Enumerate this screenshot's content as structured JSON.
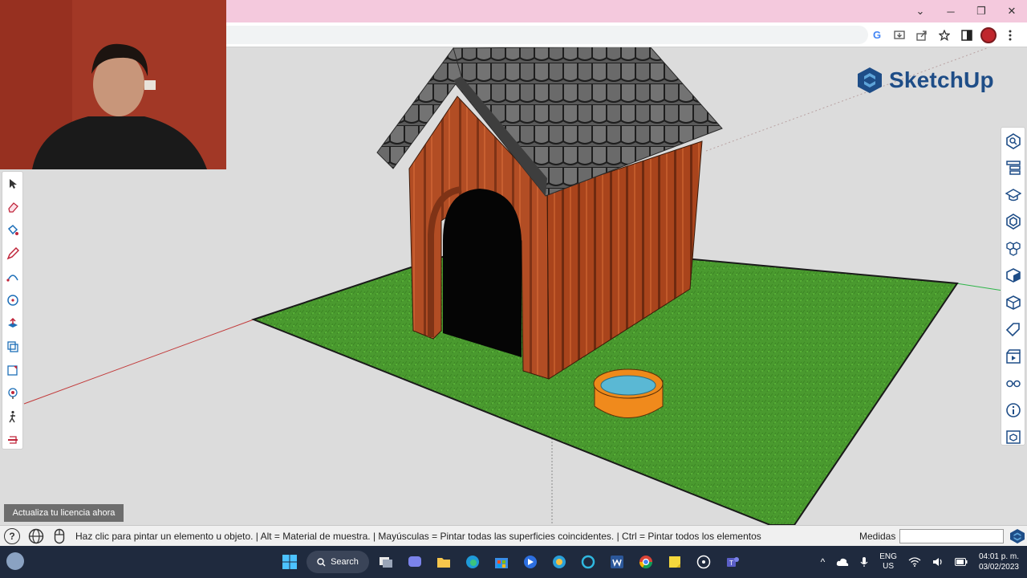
{
  "logo": {
    "text": "SketchUp"
  },
  "license_button": {
    "label": "Actualiza tu licencia ahora"
  },
  "statusbar": {
    "help_icon": "?",
    "hint": "Haz clic para pintar un elemento u objeto. | Alt = Material de muestra. | Mayúsculas = Pintar todas las superficies coincidentes. | Ctrl = Pintar todos los elementos",
    "measure_label": "Medidas",
    "measure_value": ""
  },
  "browser": {
    "window_controls": [
      "chevron-down",
      "minimize",
      "maximize",
      "close"
    ],
    "window_glyphs": [
      "⌄",
      "─",
      "❐",
      "✕"
    ],
    "g_letter": "G"
  },
  "taskbar": {
    "search_label": "Search",
    "language_line1": "ENG",
    "language_line2": "US",
    "time": "04:01 p. m.",
    "date": "03/02/2023"
  },
  "left_tools": [
    "select",
    "eraser",
    "paint-bucket",
    "pencil",
    "arc",
    "rotate",
    "push-pull",
    "offset",
    "scale",
    "position-camera",
    "walk",
    "section-plane"
  ],
  "right_tools": [
    "instructor",
    "outliner",
    "trays",
    "styles",
    "components",
    "materials",
    "entity-info",
    "tags",
    "scenes",
    "display",
    "info",
    "3d-warehouse"
  ],
  "colors": {
    "accent": "#1e4d87",
    "titlebar": "#f4c9dd",
    "taskbar": "#1f2a3e",
    "grass": "#4a9a2f",
    "wood": "#b24d24",
    "roof": "#5c5c5c",
    "bowl": "#f08a1c",
    "water": "#5ab8d4"
  }
}
